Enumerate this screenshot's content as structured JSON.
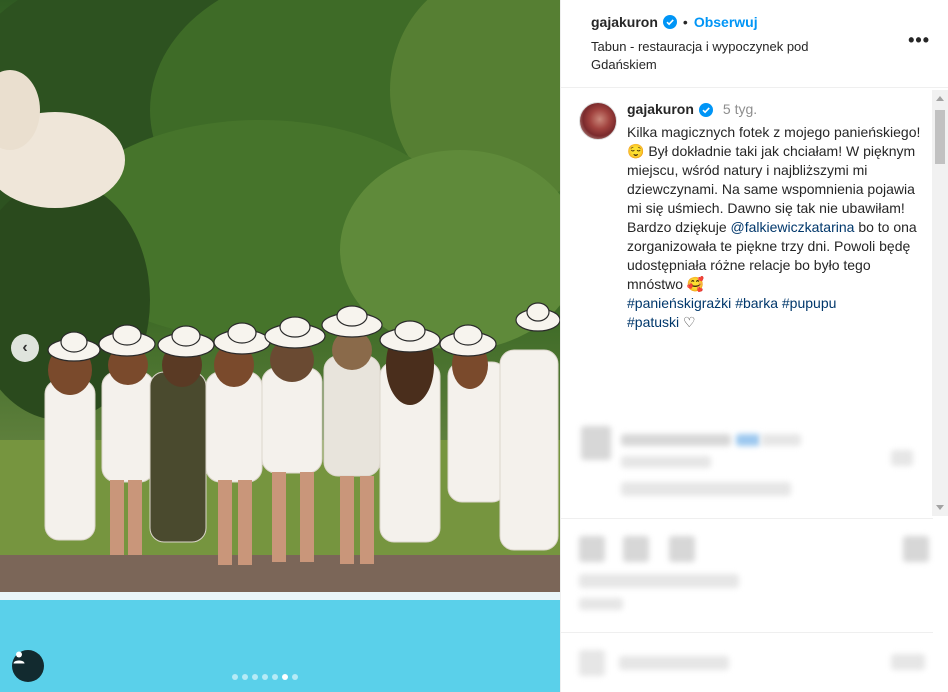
{
  "post": {
    "username": "gajakuron",
    "follow_label": "Obserwuj",
    "separator": "•",
    "location": "Tabun - restauracja i wypoczynek pod Gdańskiem",
    "more_label": "•••"
  },
  "caption": {
    "username": "gajakuron",
    "time": "5 tyg.",
    "text_1": "Kilka magicznych fotek z mojego panieńskiego!😌 Był dokładnie taki jak chciałam! W pięknym miejscu, wśród natury i najbliższymi mi dziewczynami. Na same wspomnienia pojawia mi się uśmiech. Dawno się tak nie ubawiłam! Bardzo dziękuje ",
    "mention": "@falkiewiczkatarina",
    "text_2": " bo to ona zorganizowała te piękne trzy dni. Powoli będę udostępniała różne relacje bo było tego mnóstwo 🥰",
    "hashtag_1": "#panieńskigrażki",
    "hashtag_2": "#barka",
    "hashtag_3": "#pupupu",
    "hashtag_4": "#patuski",
    "heart": "♡"
  },
  "carousel": {
    "prev_icon": "chevron-left-icon",
    "slides_total": 7,
    "active_slide": 6
  },
  "colors": {
    "accent": "#0095f6",
    "verified": "#0095f6",
    "link": "#00376b",
    "muted": "#8e8e8e"
  }
}
